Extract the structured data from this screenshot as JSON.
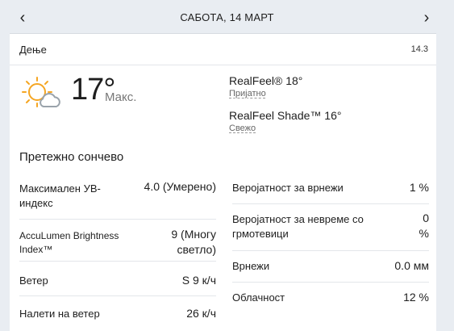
{
  "nav": {
    "prev_icon": "‹",
    "next_icon": "›",
    "date": "САБОТА, 14 МАРТ"
  },
  "header": {
    "period": "Дење",
    "time": "14.3"
  },
  "current": {
    "icon": "partly-sunny-icon",
    "temperature": "17°",
    "temp_label": "Макс.",
    "realfeel": "RealFeel® 18°",
    "realfeel_desc": "Пријатно",
    "realfeel_shade": "RealFeel Shade™ 16°",
    "realfeel_shade_desc": "Свежо",
    "summary": "Претежно сончево"
  },
  "details_left": [
    {
      "label": "Максимален УВ-индекс",
      "value": "4.0 (Умерено)"
    },
    {
      "label": "AccuLumen Brightness Index™",
      "value": "9 (Многу светло)"
    },
    {
      "label": "Ветер",
      "value": "S 9 к/ч"
    },
    {
      "label": "Налети на ветер",
      "value": "26 к/ч"
    }
  ],
  "details_right": [
    {
      "label": "Веројатност за врнежи",
      "value": "1 %"
    },
    {
      "label": "Веројатност за невреме со грмотевици",
      "value": "0 %"
    },
    {
      "label": "Врнежи",
      "value": "0.0 мм"
    },
    {
      "label": "Облачност",
      "value": "12 %"
    }
  ],
  "colors": {
    "sun": "#f5a623",
    "cloud": "#9aa3ab",
    "background": "#e9edf2"
  }
}
